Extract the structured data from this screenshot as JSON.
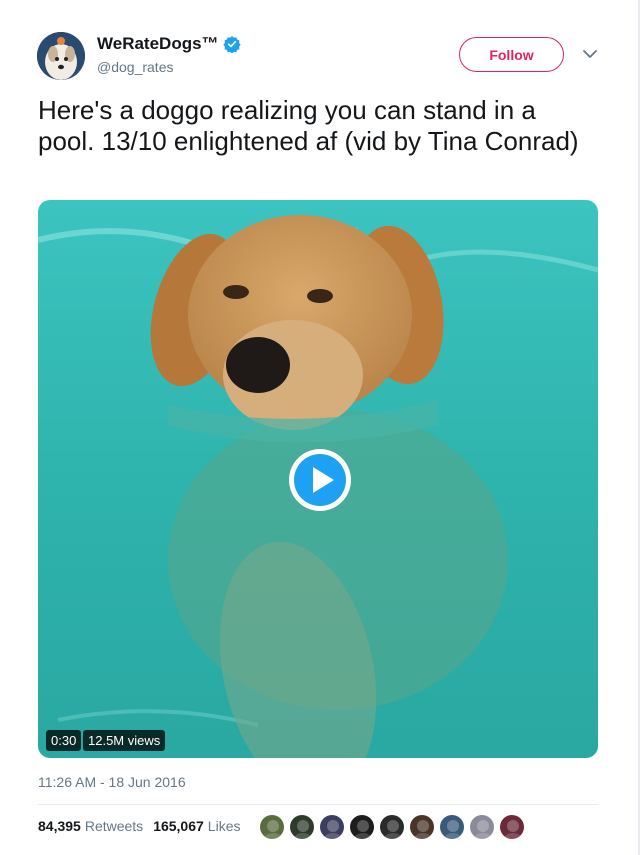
{
  "author": {
    "name": "WeRateDogs™",
    "handle": "@dog_rates",
    "verified": true
  },
  "follow_label": "Follow",
  "tweet": {
    "text": "Here's a doggo realizing you can stand in a pool. 13/10 enlightened af (vid by Tina Conrad)"
  },
  "media": {
    "duration": "0:30",
    "views": "12.5M views"
  },
  "timestamp": "11:26 AM - 18 Jun 2016",
  "stats": {
    "retweets_count": "84,395",
    "retweets_label": "Retweets",
    "likes_count": "165,067",
    "likes_label": "Likes"
  },
  "likers": [
    {
      "color": "#5a6b3e"
    },
    {
      "color": "#2e3a2a"
    },
    {
      "color": "#3b3f5c"
    },
    {
      "color": "#1d1d1d"
    },
    {
      "color": "#2a2a2a"
    },
    {
      "color": "#4a3328"
    },
    {
      "color": "#3a5a7a"
    },
    {
      "color": "#8a8a9a"
    },
    {
      "color": "#6a2a3a"
    }
  ],
  "colors": {
    "accent": "#e0245e",
    "verified": "#1da1f2",
    "secondary_text": "#657786",
    "pool": "#2fb8b0"
  }
}
